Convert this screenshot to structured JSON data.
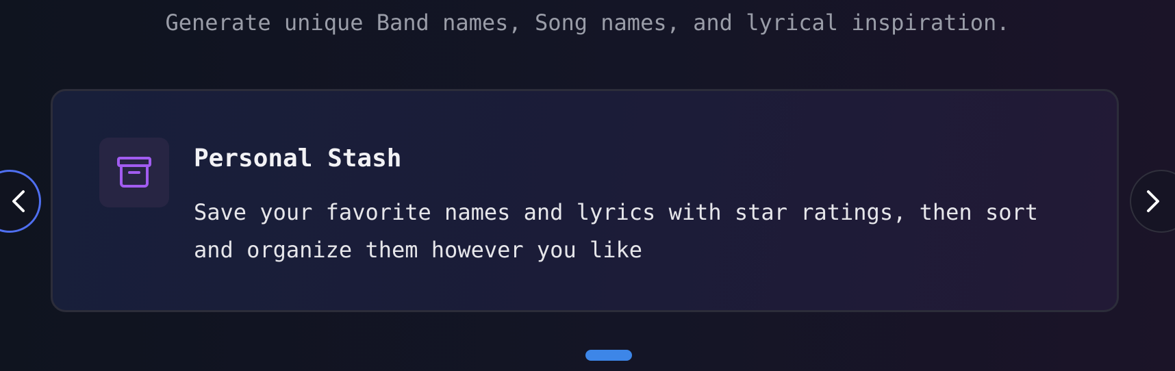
{
  "header": {
    "tagline": "Generate unique Band names, Song names, and lyrical inspiration."
  },
  "carousel": {
    "slide": {
      "icon": "archive-box-icon",
      "title": "Personal Stash",
      "description": "Save your favorite names and lyrics with star ratings, then sort and organize them however you like"
    },
    "prev_icon": "chevron-left-icon",
    "next_icon": "chevron-right-icon",
    "active_index": 1,
    "colors": {
      "accent_icon": "#a15cf0",
      "indicator": "#3d86e8",
      "prev_border": "#4f6ff0"
    }
  }
}
